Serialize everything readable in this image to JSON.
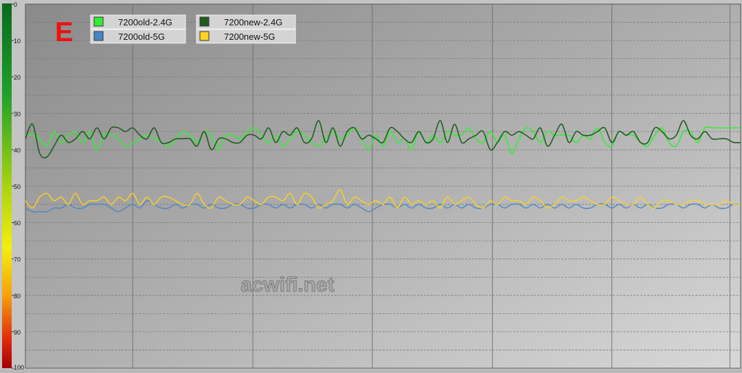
{
  "chart_data": {
    "type": "line",
    "corner_label": "E",
    "watermark": "acwifi.net",
    "y_axis": {
      "min": 0,
      "max": 100,
      "inverted": true,
      "ticks": [
        0,
        10,
        20,
        30,
        40,
        50,
        60,
        70,
        80,
        90,
        100
      ]
    },
    "x_range": [
      0,
      100
    ],
    "grid": true,
    "legend_placement": "top-left",
    "series": [
      {
        "name": "7200old-2.4G",
        "color": "#33ee33",
        "values": [
          36,
          36,
          37,
          39,
          35,
          38,
          36,
          35,
          38,
          35,
          40,
          36,
          36,
          37,
          39,
          38,
          37,
          36,
          37,
          38,
          39,
          37,
          35,
          36,
          38,
          35,
          36,
          40,
          36,
          36,
          37,
          35,
          34,
          36,
          38,
          36,
          39,
          37,
          35,
          36,
          38,
          39,
          37,
          35,
          37,
          36,
          34,
          37,
          40,
          36,
          39,
          35,
          38,
          37,
          40,
          35,
          38,
          36,
          38,
          35,
          36,
          36,
          34,
          37,
          38,
          35,
          38,
          36,
          41,
          37,
          34,
          35,
          38,
          35,
          36,
          36,
          36,
          38,
          36,
          37,
          34,
          38,
          39,
          35,
          36,
          36,
          38,
          39,
          36,
          34,
          38,
          39,
          35,
          35,
          38,
          34,
          34,
          34,
          34,
          34,
          34
        ]
      },
      {
        "name": "7200new-2.4G",
        "color": "#1e5c1e",
        "values": [
          37,
          33,
          41,
          42,
          39,
          36,
          38,
          37,
          35,
          37,
          34,
          37,
          34,
          34,
          35,
          34,
          36,
          37,
          34,
          38,
          38,
          37,
          37,
          37,
          39,
          35,
          40,
          37,
          37,
          38,
          38,
          36,
          36,
          37,
          34,
          38,
          35,
          36,
          34,
          38,
          37,
          32,
          38,
          34,
          39,
          35,
          34,
          37,
          36,
          37,
          38,
          34,
          35,
          37,
          38,
          35,
          38,
          37,
          32,
          38,
          33,
          38,
          37,
          36,
          35,
          40,
          38,
          35,
          36,
          35,
          36,
          37,
          34,
          39,
          36,
          33,
          38,
          35,
          36,
          36,
          35,
          34,
          38,
          35,
          36,
          35,
          38,
          38,
          34,
          35,
          37,
          36,
          32,
          36,
          37,
          35,
          37,
          37,
          37,
          38,
          38
        ]
      },
      {
        "name": "7200old-5G",
        "color": "#4a86c5",
        "values": [
          56,
          57,
          57,
          57,
          56,
          56,
          55,
          56,
          56,
          55,
          55,
          55,
          56,
          57,
          56,
          55,
          56,
          54,
          55,
          56,
          56,
          55,
          56,
          55,
          55,
          56,
          55,
          56,
          56,
          55,
          55,
          56,
          56,
          55,
          55,
          56,
          55,
          56,
          55,
          55,
          56,
          55,
          56,
          55,
          55,
          56,
          55,
          56,
          57,
          56,
          55,
          55,
          56,
          55,
          56,
          55,
          56,
          56,
          55,
          56,
          55,
          56,
          55,
          56,
          56,
          55,
          55,
          56,
          55,
          55,
          56,
          55,
          56,
          55,
          56,
          55,
          56,
          55,
          56,
          56,
          55,
          55,
          56,
          55,
          56,
          55,
          56,
          55,
          56,
          56,
          55,
          55,
          56,
          55,
          55,
          56,
          55,
          56,
          56,
          55,
          55
        ]
      },
      {
        "name": "7200new-5G",
        "color": "#ffd21f",
        "values": [
          54,
          56,
          53,
          52,
          54,
          53,
          55,
          52,
          55,
          54,
          54,
          53,
          55,
          53,
          54,
          52,
          55,
          53,
          55,
          53,
          53,
          54,
          55,
          55,
          52,
          55,
          56,
          53,
          54,
          55,
          55,
          53,
          54,
          55,
          53,
          53,
          54,
          52,
          55,
          52,
          53,
          56,
          55,
          54,
          51,
          55,
          53,
          54,
          55,
          54,
          55,
          53,
          56,
          53,
          55,
          54,
          55,
          54,
          56,
          53,
          55,
          54,
          53,
          55,
          56,
          54,
          55,
          53,
          54,
          54,
          55,
          53,
          54,
          56,
          55,
          53,
          54,
          54,
          53,
          54,
          55,
          55,
          53,
          54,
          55,
          55,
          53,
          55,
          56,
          54,
          54,
          55,
          55,
          54,
          54,
          55,
          55,
          55,
          54,
          55,
          55
        ]
      }
    ]
  }
}
